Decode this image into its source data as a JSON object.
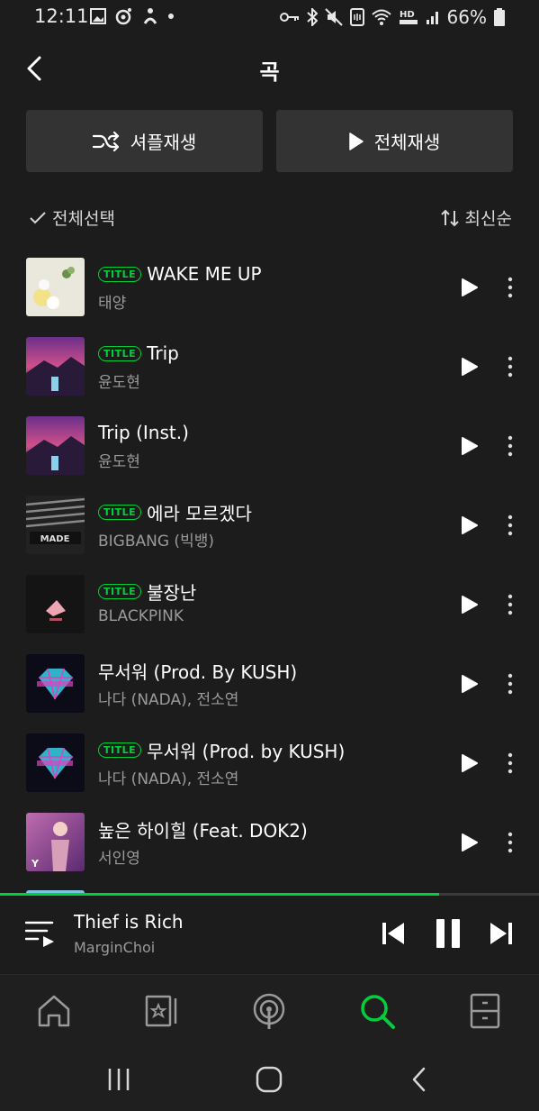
{
  "status_bar": {
    "time": "12:11",
    "battery": "66%"
  },
  "header": {
    "title": "곡"
  },
  "actions": {
    "shuffle_label": "셔플재생",
    "play_all_label": "전체재생"
  },
  "list_controls": {
    "select_all": "전체선택",
    "sort": "최신순"
  },
  "title_badge": "TITLE",
  "songs": [
    {
      "title": "WAKE ME UP",
      "artist": "태양",
      "is_title": true
    },
    {
      "title": "Trip",
      "artist": "윤도현",
      "is_title": true
    },
    {
      "title": "Trip (Inst.)",
      "artist": "윤도현",
      "is_title": false
    },
    {
      "title": "에라 모르겠다",
      "artist": "BIGBANG (빅뱅)",
      "is_title": true
    },
    {
      "title": "불장난",
      "artist": "BLACKPINK",
      "is_title": true
    },
    {
      "title": "무서워 (Prod. By KUSH)",
      "artist": "나다 (NADA), 전소연",
      "is_title": false
    },
    {
      "title": "무서워 (Prod. by KUSH)",
      "artist": "나다 (NADA), 전소연",
      "is_title": true
    },
    {
      "title": "높은 하이힐 (Feat. DOK2)",
      "artist": "서인영",
      "is_title": false
    }
  ],
  "now_playing": {
    "title": "Thief is Rich",
    "artist": "MarginChoi",
    "progress_fraction": 0.815
  },
  "bottom_nav": [
    {
      "icon": "home-icon"
    },
    {
      "icon": "library-icon"
    },
    {
      "icon": "podcast-icon"
    },
    {
      "icon": "search-icon",
      "active": true
    },
    {
      "icon": "storage-icon"
    }
  ],
  "colors": {
    "accent": "#00d13a",
    "background": "#1c1c1c",
    "button": "#333333",
    "secondary_text": "#9a9a9a"
  }
}
